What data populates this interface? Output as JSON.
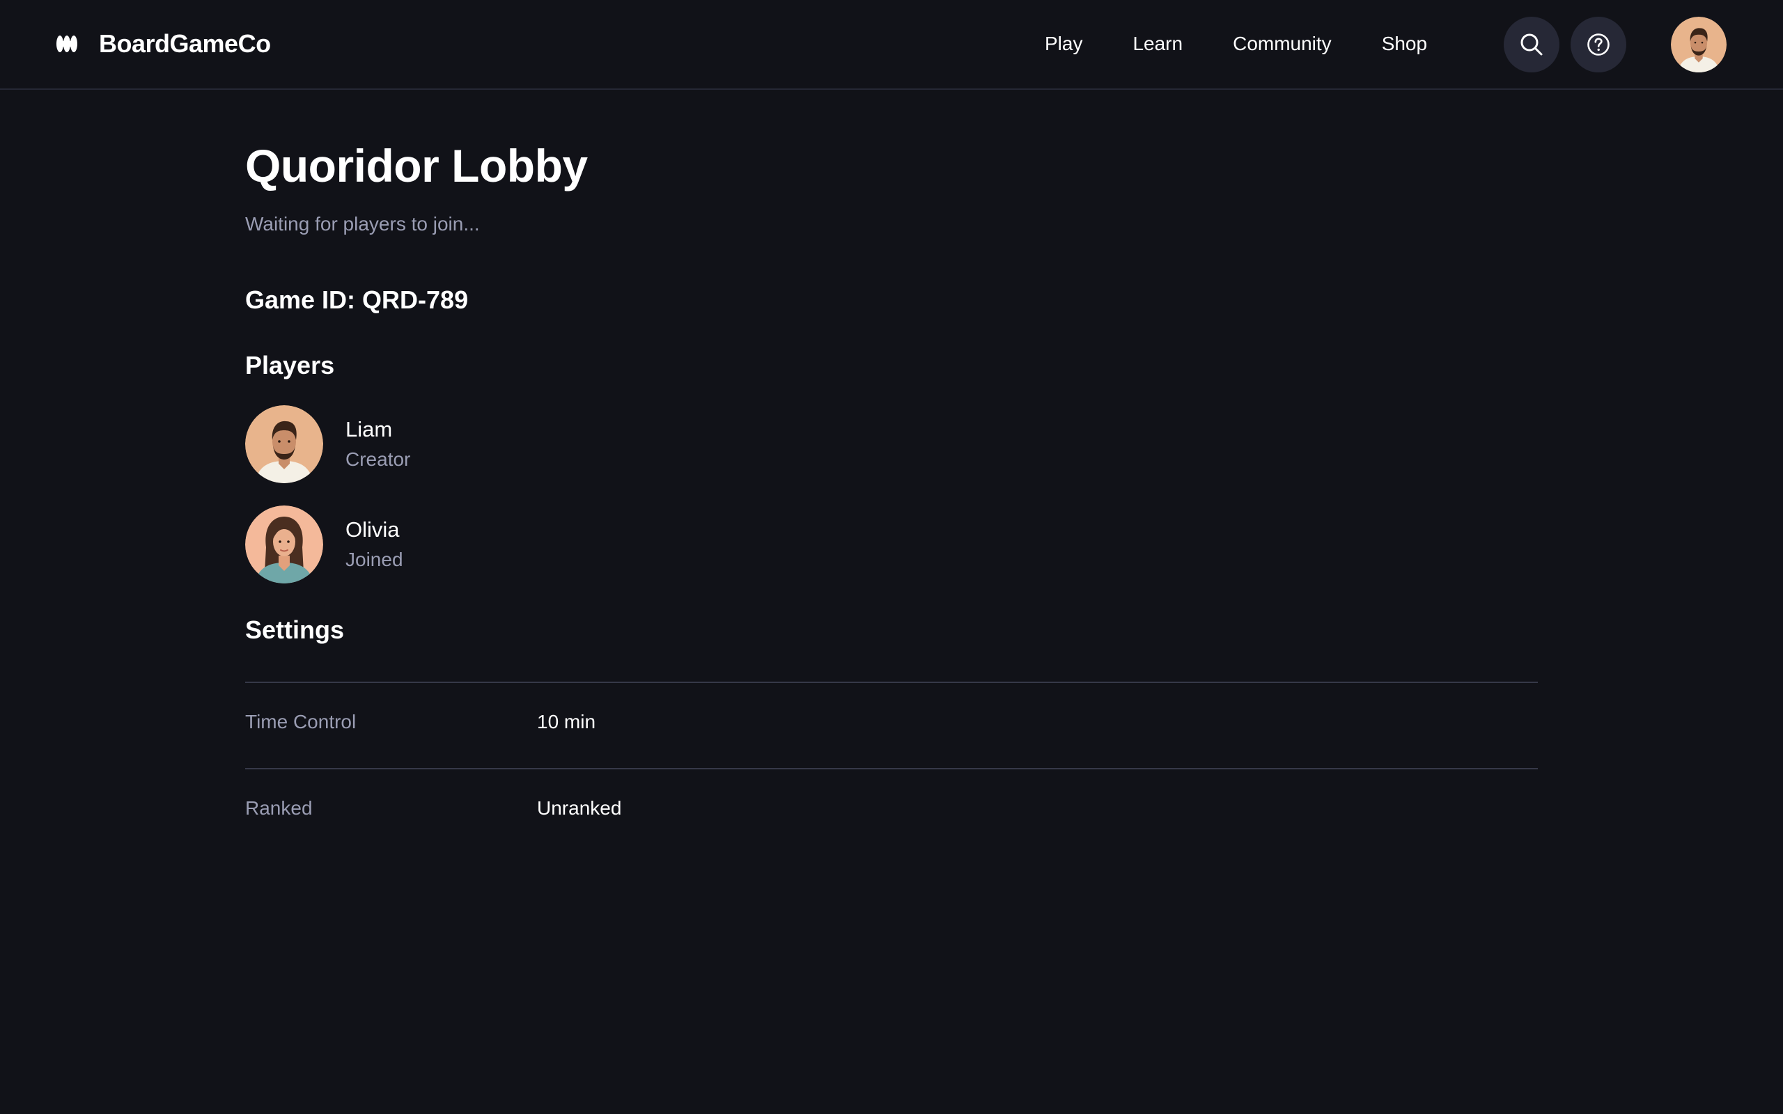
{
  "app": {
    "brand_name": "BoardGameCo",
    "logo_icon": "brand-logo-icon"
  },
  "nav": {
    "links": [
      "Play",
      "Learn",
      "Community",
      "Shop"
    ],
    "search_icon": "search-icon",
    "help_icon": "help-circle-icon",
    "user_avatar": "user-avatar"
  },
  "lobby": {
    "title": "Quoridor Lobby",
    "subtitle": "Waiting for players to join...",
    "game_id": "Game ID: QRD-789",
    "players_heading": "Players",
    "players": [
      {
        "name": "Liam",
        "role": "Creator",
        "avatar": "male-avatar"
      },
      {
        "name": "Olivia",
        "role": "Joined",
        "avatar": "female-avatar"
      }
    ],
    "settings_heading": "Settings",
    "settings": [
      {
        "label": "Time Control",
        "value": "10 min"
      },
      {
        "label": "Ranked",
        "value": "Unranked"
      }
    ]
  },
  "colors": {
    "background": "#111218",
    "icon_button_bg": "#262836",
    "muted_text": "#9a9db3",
    "divider": "#363848",
    "avatar_skin": "#e8b48c"
  }
}
